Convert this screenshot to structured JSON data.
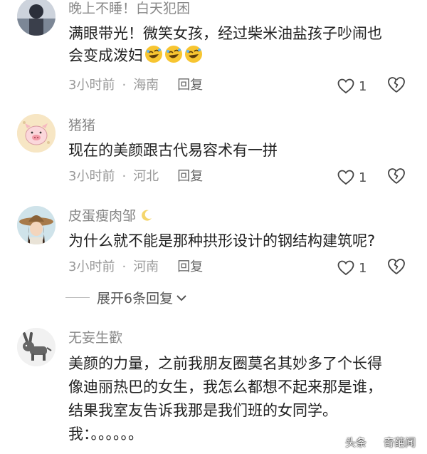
{
  "comments": [
    {
      "username": "晚上不睡！白天犯困",
      "body_line1": "满眼带光！微笑女孩，经过柴米油盐孩子吵闹也",
      "body_line2": "会变成泼妇",
      "emoji": "rolling-on-floor-laughing-icon x3",
      "time": "3小时前",
      "location": "海南",
      "reply_label": "回复",
      "likes": "1"
    },
    {
      "username": "猪猪",
      "body_line1": "现在的美颜跟古代易容术有一拼",
      "time": "3小时前",
      "location": "河北",
      "reply_label": "回复",
      "likes": "1"
    },
    {
      "username": "皮蛋瘦肉邹",
      "body_line1": "为什么就不能是那种拱形设计的钢结构建筑呢?",
      "time": "3小时前",
      "location": "河南",
      "reply_label": "回复",
      "likes": "1"
    },
    {
      "username": "无妄生歡",
      "body_line1": "美颜的力量，之前我朋友圈莫名其妙多了个长得",
      "body_line2": "像迪丽热巴的女生，我怎么都想不起来那是谁，",
      "body_line3": "结果我室友告诉我那是我们班的女同学。",
      "body_line4": "我：。。。。。。"
    }
  ],
  "expand_replies": "展开6条回复",
  "separator": "·",
  "watermark": {
    "prefix": "头条",
    "handle": "奇葩闻"
  },
  "colors": {
    "meta_gray": "#999999",
    "username_gray": "#888888",
    "text": "#222222"
  }
}
